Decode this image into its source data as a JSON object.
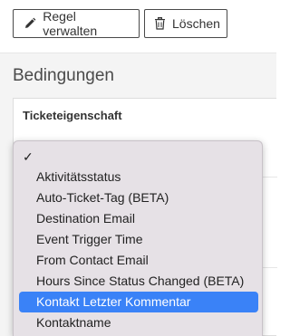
{
  "toolbar": {
    "manage_label": "Regel verwalten",
    "delete_label": "Löschen",
    "manage_icon": "pencil-icon",
    "delete_icon": "trash-icon"
  },
  "section": {
    "title": "Bedingungen"
  },
  "card": {
    "label": "Ticketeigenschaft"
  },
  "dropdown": {
    "check_glyph": "✓",
    "items": [
      "Aktivitätsstatus",
      "Auto-Ticket-Tag (BETA)",
      "Destination Email",
      "Event Trigger Time",
      "From Contact Email",
      "Hours Since Status Changed (BETA)",
      "Kontakt Letzter Kommentar",
      "Kontaktname"
    ],
    "selected_item": "Kontakt Letzter Kommentar"
  },
  "colors": {
    "selection": "#3a82f7",
    "menu_bg": "#e6e1e6",
    "page_bg": "#f4f4f4"
  }
}
